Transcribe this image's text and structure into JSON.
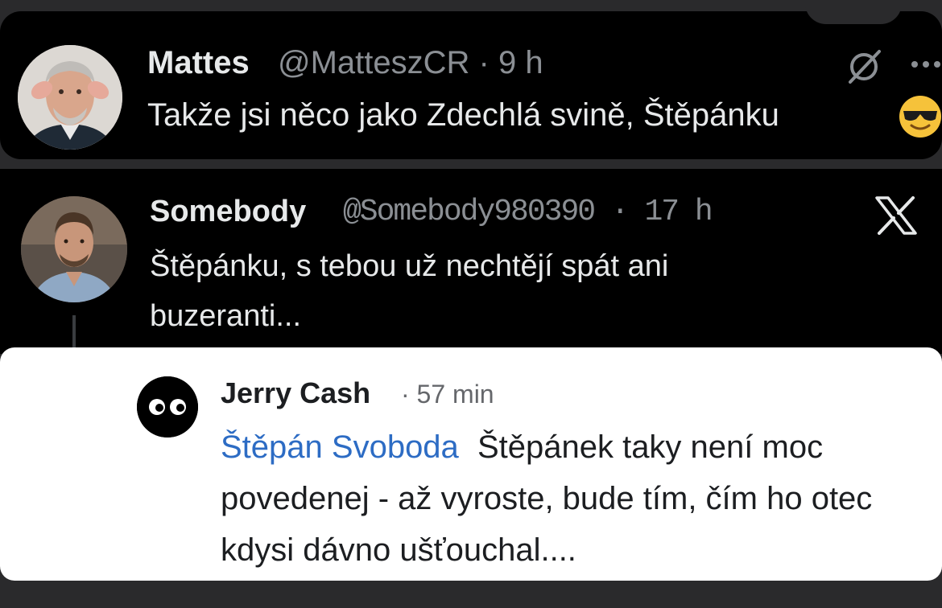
{
  "tweet1": {
    "name": "Mattes",
    "handle": "@MatteszCR",
    "dot": "·",
    "time": "9 h",
    "text": "Takže jsi něco jako Zdechlá svině, Štěpánku",
    "emoji_name": "smiling-face-with-sunglasses",
    "icons": [
      "grok-icon",
      "more-icon"
    ]
  },
  "tweet2": {
    "name": "Somebody",
    "handle": "@Somebody980390",
    "dot": "·",
    "time": "17 h",
    "text": "Štěpánku, s tebou už nechtějí spát ani buzeranti...",
    "icons": [
      "x-logo-icon"
    ]
  },
  "comment": {
    "name": "Jerry Cash",
    "dot": "·",
    "time": "57 min",
    "mention": "Štěpán Svoboda",
    "text": "Štěpánek taky není moc povedenej - až vyroste, bude tím, čím ho otec kdysi dávno ušťouchal....",
    "mention_color": "#2d6cc4"
  }
}
